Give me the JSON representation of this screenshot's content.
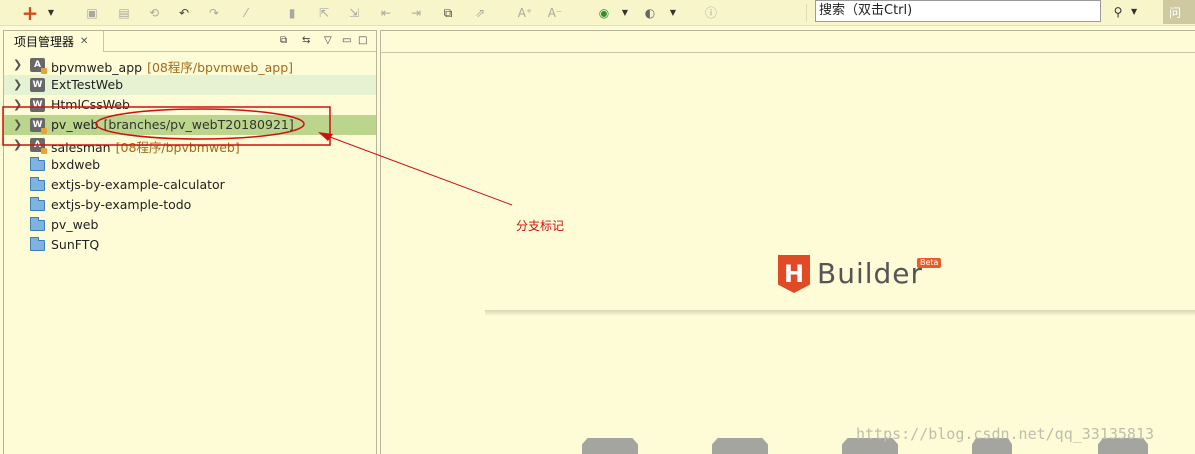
{
  "toolbar": {
    "icons": [
      "plus-icon",
      "dropdown-arrow",
      "save-icon",
      "save-all-icon",
      "revert-icon",
      "undo-icon",
      "redo-icon",
      "format-icon",
      "bookmark-icon",
      "go-back-icon",
      "go-forward-icon",
      "jump-start-icon",
      "jump-end-icon",
      "preview-icon",
      "run-icon",
      "font-increase-icon",
      "font-decrease-icon",
      "run-browser-icon",
      "phone-run-icon",
      "help-icon"
    ],
    "search_placeholder": "搜索（双击Ctrl)",
    "ask_label": "问"
  },
  "panel": {
    "title": "项目管理器",
    "icons": [
      "minimize-icon",
      "link-icon",
      "view-menu-icon",
      "minimize-panel-icon",
      "maximize-panel-icon"
    ]
  },
  "tree": [
    {
      "label": "bpvmweb_app",
      "sub": "[08程序/bpvmweb_app]",
      "type": "app",
      "state": "normal"
    },
    {
      "label": "ExtTestWeb",
      "sub": "",
      "type": "web",
      "state": "alt"
    },
    {
      "label": "HtmlCssWeb",
      "sub": "",
      "type": "web",
      "state": "normal"
    },
    {
      "label": "pv_web",
      "sub": "[branches/pv_webT20180921]",
      "type": "web-badge",
      "state": "selected"
    },
    {
      "label": "salesman",
      "sub": "[08程序/bpvbmweb]",
      "type": "app",
      "state": "normal"
    },
    {
      "label": "bxdweb",
      "sub": "",
      "type": "folder",
      "state": "normal"
    },
    {
      "label": "extjs-by-example-calculator",
      "sub": "",
      "type": "folder",
      "state": "normal"
    },
    {
      "label": "extjs-by-example-todo",
      "sub": "",
      "type": "folder",
      "state": "normal"
    },
    {
      "label": "pv_web",
      "sub": "",
      "type": "folder",
      "state": "normal"
    },
    {
      "label": "SunFTQ",
      "sub": "",
      "type": "folder",
      "state": "normal"
    }
  ],
  "annotation": {
    "label": "分支标记",
    "color": "#d01010"
  },
  "logo": {
    "letter": "H",
    "text": "Builder",
    "badge": "Beta"
  },
  "watermark": "https://blog.csdn.net/qq_33135813",
  "colors": {
    "background": "#fdfcd6",
    "selected_row": "#bcd58c",
    "alt_row": "#e5f3d2",
    "logo_red": "#e04a25"
  }
}
